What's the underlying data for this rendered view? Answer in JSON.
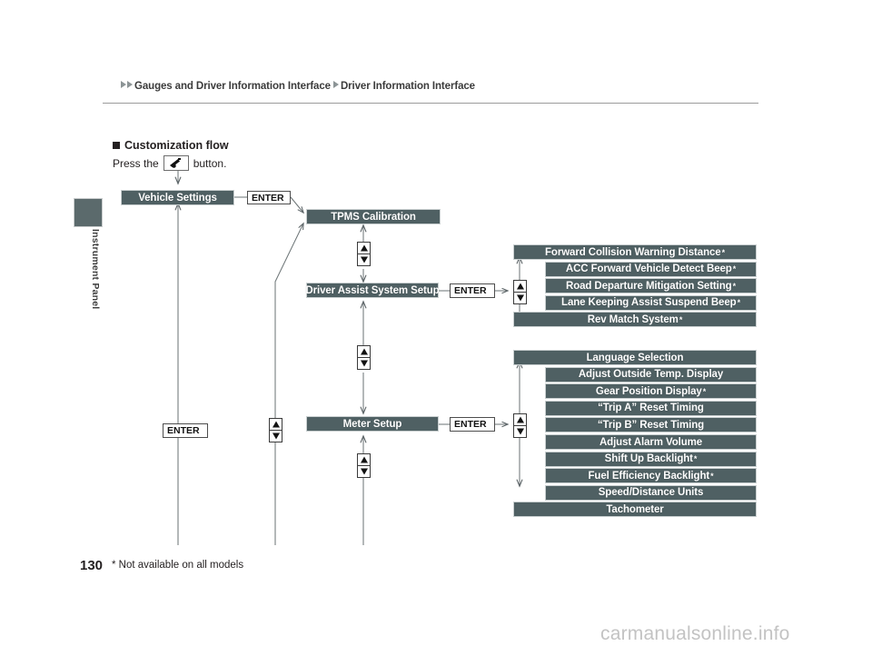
{
  "breadcrumb": {
    "first": "Gauges and Driver Information Interface",
    "second": "Driver Information Interface"
  },
  "sidebar": {
    "tab_label": "Instrument Panel"
  },
  "section": {
    "heading": "Customization flow",
    "press_prefix": "Press the",
    "press_suffix": "button.",
    "button_icon": "display-info-button-icon"
  },
  "flow": {
    "enter_label": "ENTER",
    "level1": {
      "label": "Vehicle Settings"
    },
    "level2": [
      {
        "label": "TPMS Calibration"
      },
      {
        "label": "Driver Assist System Setup"
      },
      {
        "label": "Meter Setup"
      }
    ],
    "driver_assist_items": [
      {
        "label": "Forward Collision Warning Distance",
        "asterisk": "*",
        "wide": true
      },
      {
        "label": "ACC Forward Vehicle Detect Beep",
        "asterisk": "*",
        "wide": false
      },
      {
        "label": "Road Departure Mitigation Setting",
        "asterisk": "*",
        "wide": false
      },
      {
        "label": "Lane Keeping Assist Suspend Beep",
        "asterisk": "*",
        "wide": false
      },
      {
        "label": "Rev Match System",
        "asterisk": "*",
        "wide": true
      }
    ],
    "meter_setup_items": [
      {
        "label": "Language Selection",
        "asterisk": "",
        "wide": true
      },
      {
        "label": "Adjust Outside Temp. Display",
        "asterisk": "",
        "wide": false
      },
      {
        "label": "Gear Position Display",
        "asterisk": "*",
        "wide": false
      },
      {
        "label": "“Trip A” Reset Timing",
        "asterisk": "",
        "wide": false
      },
      {
        "label": "“Trip B” Reset Timing",
        "asterisk": "",
        "wide": false
      },
      {
        "label": "Adjust Alarm Volume",
        "asterisk": "",
        "wide": false
      },
      {
        "label": "Shift Up Backlight",
        "asterisk": "*",
        "wide": false
      },
      {
        "label": "Fuel Efficiency Backlight",
        "asterisk": "*",
        "wide": false
      },
      {
        "label": "Speed/Distance Units",
        "asterisk": "",
        "wide": false
      },
      {
        "label": "Tachometer",
        "asterisk": "",
        "wide": true
      }
    ]
  },
  "footer": {
    "page_number": "130",
    "footnote": "* Not available on all models",
    "watermark": "carmanualsonline.info"
  },
  "colors": {
    "box_fill": "#4f6063",
    "line": "#6f7779",
    "tab_fill": "#5b6a6c",
    "rule": "#9b9b9b",
    "watermark": "#c3c3c3"
  }
}
